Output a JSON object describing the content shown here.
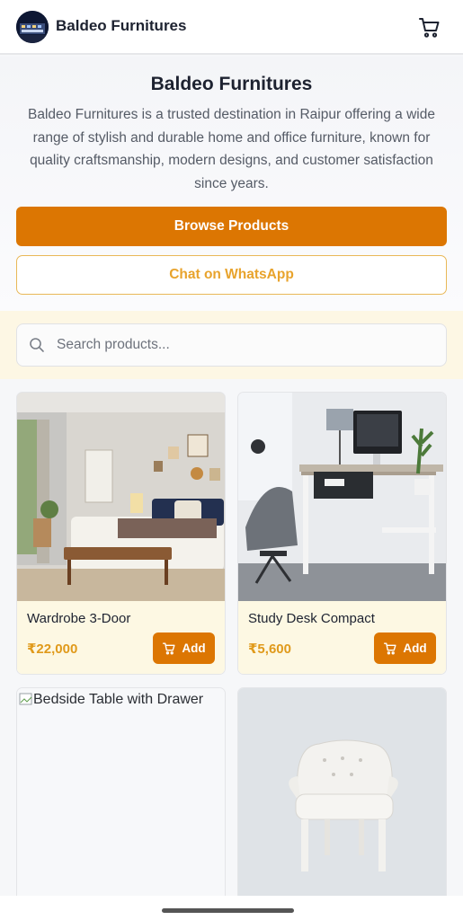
{
  "header": {
    "brand_name": "Baldeo Furnitures",
    "logo_icon": "storefront-logo",
    "cart_icon": "shopping-cart-icon"
  },
  "hero": {
    "title": "Baldeo Furnitures",
    "description": "Baldeo Furnitures is a trusted destination in Raipur offering a wide range of stylish and durable home and office furniture, known for quality craftsmanship, modern designs, and customer satisfaction since years.",
    "browse_label": "Browse Products",
    "whatsapp_label": "Chat on WhatsApp"
  },
  "search": {
    "placeholder": "Search products...",
    "value": "",
    "icon": "search-icon"
  },
  "products": [
    {
      "name": "Wardrobe 3-Door",
      "price": "₹22,000",
      "add_label": "Add",
      "image": "bedroom-photo"
    },
    {
      "name": "Study Desk Compact",
      "price": "₹5,600",
      "add_label": "Add",
      "image": "desk-photo"
    },
    {
      "name": "",
      "alt_text": "Bedside Table with Drawer",
      "image": "broken-image"
    },
    {
      "name": "",
      "image": "white-armchair-photo"
    }
  ],
  "colors": {
    "accent": "#dc7602",
    "price": "#e09a1b",
    "outline": "#e9b858",
    "band": "#fdf7e4"
  }
}
